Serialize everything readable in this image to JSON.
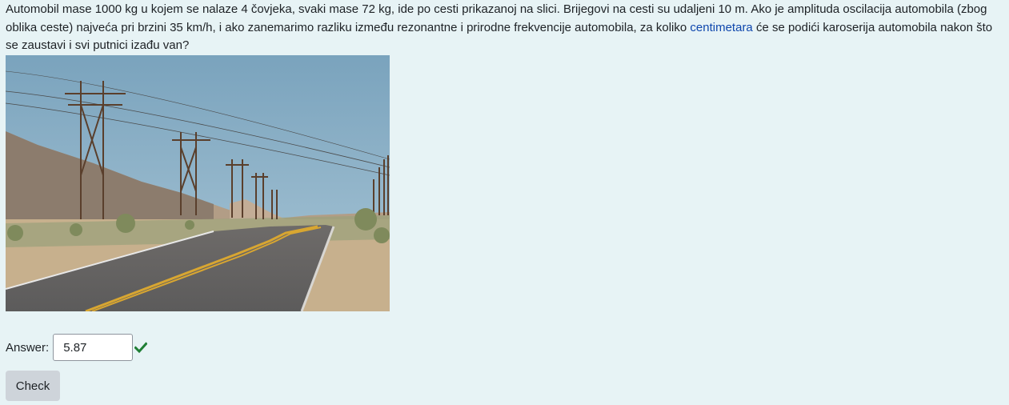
{
  "question": {
    "text_before_link": "Automobil mase 1000 kg u kojem se nalaze 4 čovjeka, svaki mase 72 kg, ide po cesti prikazanoj na slici. Brijegovi na cesti su udaljeni 10 m. Ako je amplituda oscilacija automobila (zbog oblika ceste) najveća pri brzini 35 km/h, i ako zanemarimo razliku između rezonantne i prirodne frekvencije automobila, za koliko ",
    "link_text": "centimetara",
    "text_after_link": " će se podići karoserija automobila nakon što se zaustavi i svi putnici izađu van?"
  },
  "answer": {
    "label": "Answer:",
    "value": "5.87",
    "status_icon": "check-icon",
    "status_color": "#1f7e34"
  },
  "check_button": {
    "label": "Check"
  },
  "colors": {
    "background": "#e7f3f5",
    "link": "#0f47ad",
    "button": "#ced4da"
  }
}
